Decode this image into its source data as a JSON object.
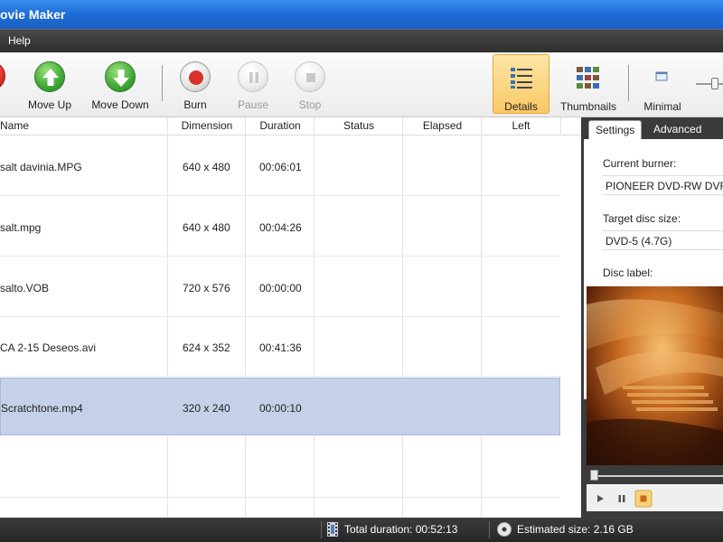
{
  "window": {
    "title": "ovie Maker"
  },
  "menu": {
    "items": [
      "Help"
    ]
  },
  "toolbar": {
    "remove_label": "ve",
    "move_up_label": "Move Up",
    "move_down_label": "Move Down",
    "burn_label": "Burn",
    "pause_label": "Pause",
    "stop_label": "Stop",
    "details_label": "Details",
    "thumbnails_label": "Thumbnails",
    "minimal_label": "Minimal"
  },
  "table": {
    "columns": [
      "Name",
      "Dimension",
      "Duration",
      "Status",
      "Elapsed",
      "Left"
    ],
    "rows": [
      {
        "name": "salt davinia.MPG",
        "dimension": "640 x 480",
        "duration": "00:06:01",
        "status": "",
        "elapsed": "",
        "left": ""
      },
      {
        "name": "salt.mpg",
        "dimension": "640 x 480",
        "duration": "00:04:26",
        "status": "",
        "elapsed": "",
        "left": ""
      },
      {
        "name": "salto.VOB",
        "dimension": "720 x 576",
        "duration": "00:00:00",
        "status": "",
        "elapsed": "",
        "left": ""
      },
      {
        "name": "CA 2-15 Deseos.avi",
        "dimension": "624 x 352",
        "duration": "00:41:36",
        "status": "",
        "elapsed": "",
        "left": ""
      },
      {
        "name": "Scratchtone.mp4",
        "dimension": "320 x 240",
        "duration": "00:00:10",
        "status": "",
        "elapsed": "",
        "left": "",
        "selected": true
      }
    ]
  },
  "panel": {
    "tabs": [
      "Settings",
      "Advanced"
    ],
    "active_tab": "Settings",
    "current_burner_label": "Current burner:",
    "current_burner_value": "PIONEER DVD-RW DVR-",
    "target_disc_size_label": "Target disc size:",
    "target_disc_size_value": "DVD-5 (4.7G)",
    "disc_label_label": "Disc label:"
  },
  "status": {
    "total_duration": "Total duration: 00:52:13",
    "estimated_size": "Estimated size: 2.16 GB"
  },
  "colors": {
    "titlebar": "#1f6fd8",
    "selection": "#c5d1e8",
    "active_view": "#f9c865",
    "statusbar": "#2e2e2e"
  }
}
